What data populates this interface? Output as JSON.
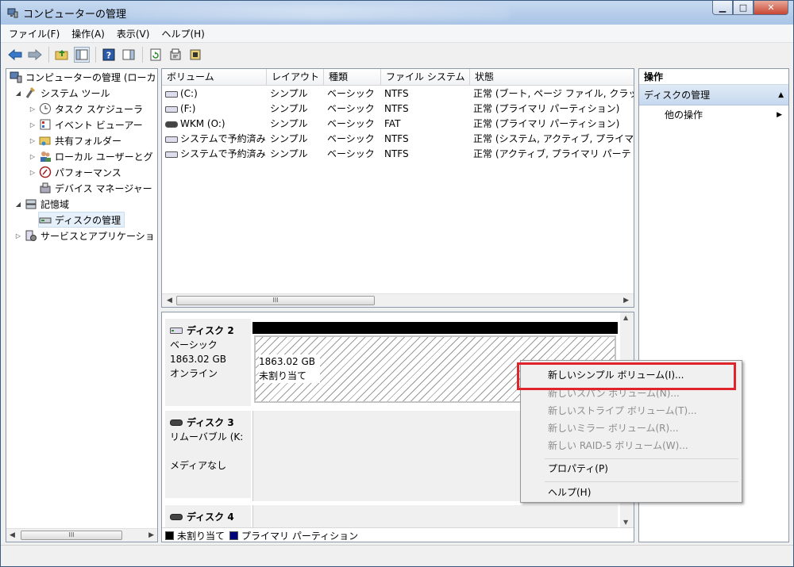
{
  "window": {
    "title": "コンピューターの管理"
  },
  "menu": [
    "ファイル(F)",
    "操作(A)",
    "表示(V)",
    "ヘルプ(H)"
  ],
  "tree": {
    "root": "コンピューターの管理 (ローカ",
    "system_tools": "システム ツール",
    "task_scheduler": "タスク スケジューラ",
    "event_viewer": "イベント ビューアー",
    "shared_folders": "共有フォルダー",
    "local_users": "ローカル ユーザーとグ",
    "performance": "パフォーマンス",
    "device_manager": "デバイス マネージャー",
    "storage": "記憶域",
    "disk_management": "ディスクの管理",
    "services": "サービスとアプリケーショ"
  },
  "scroll_thumb": "III",
  "volumes": {
    "headers": [
      "ボリューム",
      "レイアウト",
      "種類",
      "ファイル システム",
      "状態"
    ],
    "rows": [
      [
        "(C:)",
        "シンプル",
        "ベーシック",
        "NTFS",
        "正常 (ブート, ページ ファイル, クラッ"
      ],
      [
        "(F:)",
        "シンプル",
        "ベーシック",
        "NTFS",
        "正常 (プライマリ パーティション)"
      ],
      [
        "WKM (O:)",
        "シンプル",
        "ベーシック",
        "FAT",
        "正常 (プライマリ パーティション)"
      ],
      [
        "システムで予約済み",
        "シンプル",
        "ベーシック",
        "NTFS",
        "正常 (システム, アクティブ, プライマ"
      ],
      [
        "システムで予約済み",
        "シンプル",
        "ベーシック",
        "NTFS",
        "正常 (アクティブ, プライマリ パーテ"
      ]
    ]
  },
  "disks": {
    "disk2": {
      "name": "ディスク 2",
      "type": "ベーシック",
      "size": "1863.02 GB",
      "status": "オンライン",
      "part_size": "1863.02 GB",
      "part_label": "未割り当て"
    },
    "disk3": {
      "name": "ディスク 3",
      "type": "リムーバブル (K:",
      "status": "メディアなし"
    },
    "disk4": {
      "name": "ディスク 4"
    }
  },
  "legend": {
    "unallocated": "未割り当て",
    "primary": "プライマリ パーティション"
  },
  "actions": {
    "header": "操作",
    "selected": "ディスクの管理",
    "other": "他の操作"
  },
  "context_menu": {
    "new_simple": "新しいシンプル ボリューム(I)...",
    "new_spanned": "新しいスパン ボリューム(N)...",
    "new_striped": "新しいストライプ ボリューム(T)...",
    "new_mirror": "新しいミラー ボリューム(R)...",
    "new_raid5": "新しい RAID-5 ボリューム(W)...",
    "properties": "プロパティ(P)",
    "help": "ヘルプ(H)"
  },
  "colors": {
    "highlight": "#e0242c",
    "legend_unallocated": "#000000",
    "legend_primary": "#00007a"
  }
}
